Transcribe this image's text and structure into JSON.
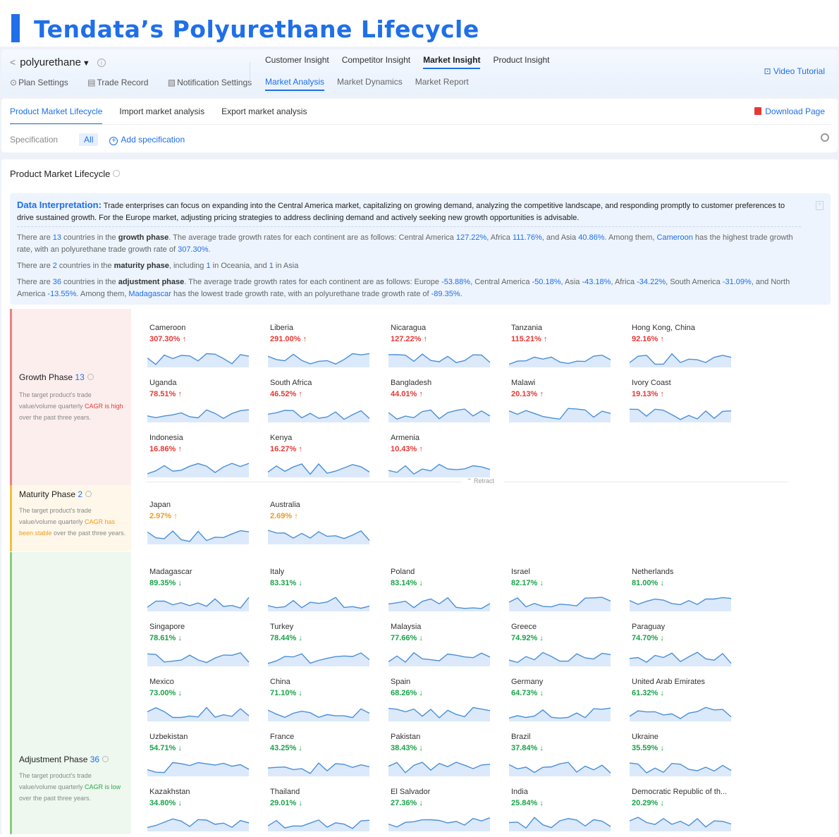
{
  "banner": {
    "title": "Tendata’s Polyurethane Lifecycle"
  },
  "header": {
    "product": "polyurethane",
    "tools": [
      "Plan Settings",
      "Trade Record",
      "Notification Settings"
    ],
    "nav_tabs": [
      "Customer Insight",
      "Competitor Insight",
      "Market Insight",
      "Product Insight"
    ],
    "active_nav": "Market Insight",
    "sub_tabs": [
      "Market Analysis",
      "Market Dynamics",
      "Market Report"
    ],
    "video_tutorial": "Video Tutorial"
  },
  "analysis_tabs": {
    "tabs": [
      "Product Market Lifecycle",
      "Import market analysis",
      "Export market analysis"
    ],
    "download": "Download Page",
    "spec_label": "Specification",
    "spec_all": "All",
    "add_spec": "Add specification"
  },
  "section_title": "Product Market Lifecycle",
  "interpretation": {
    "title": "Data Interpretation:",
    "summary": "Trade enterprises can focus on expanding into the Central America market, capitalizing on growing demand, analyzing the competitive landscape, and responding promptly to customer preferences to drive sustained growth. For the Europe market, adjusting pricing strategies to address declining demand and actively seeking new growth opportunities is advisable.",
    "growth_count": "13",
    "growth_rates": {
      "Central America": "127.22%",
      "Africa": "111.76%",
      "Asia": "40.86%"
    },
    "growth_top": {
      "country": "Cameroon",
      "rate": "307.30%"
    },
    "maturity_count": "2",
    "maturity_split": {
      "Oceania": "1",
      "Asia": "1"
    },
    "adjustment_count": "36",
    "adjustment_rates": {
      "Europe": "-53.88%",
      "Central America": "-50.18%",
      "Asia": "-43.18%",
      "Africa": "-34.22%",
      "South America": "-31.09%",
      "North America": "-13.55%"
    },
    "adjustment_bottom": {
      "country": "Madagascar",
      "rate": "-89.35%"
    }
  },
  "phases": {
    "growth": {
      "name": "Growth Phase",
      "count": "13",
      "desc_a": "The target product's trade value/volume quarterly ",
      "desc_hl": "CAGR is high",
      "desc_b": " over the past three years.",
      "color": "#e53935"
    },
    "maturity": {
      "name": "Maturity Phase",
      "count": "2",
      "desc_a": "The target product's trade value/volume quarterly ",
      "desc_hl": "CAGR has been stable",
      "desc_b": " over the past three years.",
      "color": "#f09a1a"
    },
    "adjustment": {
      "name": "Adjustment Phase",
      "count": "36",
      "desc_a": "The target product's trade value/volume quarterly ",
      "desc_hl": "CAGR is low",
      "desc_b": " over the past three years.",
      "color": "#2ea84e"
    }
  },
  "retract": "Retract",
  "countries": {
    "growth": [
      {
        "name": "Cameroon",
        "value": "307.30%"
      },
      {
        "name": "Liberia",
        "value": "291.00%"
      },
      {
        "name": "Nicaragua",
        "value": "127.22%"
      },
      {
        "name": "Tanzania",
        "value": "115.21%"
      },
      {
        "name": "Hong Kong, China",
        "value": "92.16%"
      },
      {
        "name": "Uganda",
        "value": "78.51%"
      },
      {
        "name": "South Africa",
        "value": "46.52%"
      },
      {
        "name": "Bangladesh",
        "value": "44.01%"
      },
      {
        "name": "Malawi",
        "value": "20.13%"
      },
      {
        "name": "Ivory Coast",
        "value": "19.13%"
      },
      {
        "name": "Indonesia",
        "value": "16.86%"
      },
      {
        "name": "Kenya",
        "value": "16.27%"
      },
      {
        "name": "Armenia",
        "value": "10.43%"
      }
    ],
    "maturity": [
      {
        "name": "Japan",
        "value": "2.97%"
      },
      {
        "name": "Australia",
        "value": "2.69%"
      }
    ],
    "adjustment": [
      {
        "name": "Madagascar",
        "value": "89.35%"
      },
      {
        "name": "Italy",
        "value": "83.31%"
      },
      {
        "name": "Poland",
        "value": "83.14%"
      },
      {
        "name": "Israel",
        "value": "82.17%"
      },
      {
        "name": "Netherlands",
        "value": "81.00%"
      },
      {
        "name": "Singapore",
        "value": "78.61%"
      },
      {
        "name": "Turkey",
        "value": "78.44%"
      },
      {
        "name": "Malaysia",
        "value": "77.66%"
      },
      {
        "name": "Greece",
        "value": "74.92%"
      },
      {
        "name": "Paraguay",
        "value": "74.70%"
      },
      {
        "name": "Mexico",
        "value": "73.00%"
      },
      {
        "name": "China",
        "value": "71.10%"
      },
      {
        "name": "Spain",
        "value": "68.26%"
      },
      {
        "name": "Germany",
        "value": "64.73%"
      },
      {
        "name": "United Arab Emirates",
        "value": "61.32%"
      },
      {
        "name": "Uzbekistan",
        "value": "54.71%"
      },
      {
        "name": "France",
        "value": "43.25%"
      },
      {
        "name": "Pakistan",
        "value": "38.43%"
      },
      {
        "name": "Brazil",
        "value": "37.84%"
      },
      {
        "name": "Ukraine",
        "value": "35.59%"
      },
      {
        "name": "Kazakhstan",
        "value": "34.80%"
      },
      {
        "name": "Thailand",
        "value": "29.01%"
      },
      {
        "name": "El Salvador",
        "value": "27.36%"
      },
      {
        "name": "India",
        "value": "25.84%"
      },
      {
        "name": "Democratic Republic of th...",
        "value": "20.29%"
      }
    ]
  },
  "colors": {
    "accent": "#1f6fe8",
    "up": "#e53935",
    "down": "#1aa34a",
    "stable": "#f09a1a",
    "spark": "#4a90d9"
  }
}
